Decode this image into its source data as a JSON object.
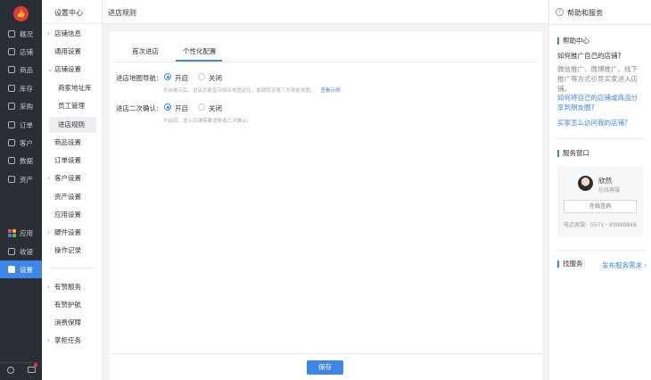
{
  "nav": {
    "logo_glyph": "👍",
    "items": [
      {
        "label": "概况",
        "icon": "overview-icon"
      },
      {
        "label": "店铺",
        "icon": "store-icon"
      },
      {
        "label": "商品",
        "icon": "tag-icon"
      },
      {
        "label": "库存",
        "icon": "inventory-icon"
      },
      {
        "label": "采购",
        "icon": "purchase-icon"
      },
      {
        "label": "订单",
        "icon": "order-icon"
      },
      {
        "label": "客户",
        "icon": "customer-icon"
      },
      {
        "label": "数据",
        "icon": "chart-icon"
      },
      {
        "label": "资产",
        "icon": "asset-icon"
      }
    ],
    "apps": "应用",
    "cashier": "收银",
    "settings": "设置",
    "accent": "#3b86e8"
  },
  "menu": {
    "title": "设置中心",
    "store_info": "店铺信息",
    "general": "通用设置",
    "store_settings": "店铺设置",
    "merchant_address": "商家地址库",
    "staff": "员工管理",
    "entry_rules": "进店规则",
    "product_settings": "商品设置",
    "order_settings": "订单设置",
    "customer_settings": "客户设置",
    "asset_settings": "资产设置",
    "app_settings": "应用设置",
    "hardware": "硬件设置",
    "logs": "操作记录",
    "youzan_service": "有赞服务",
    "youzan_guard": "有赞护航",
    "consumer_guarantee": "消费保障",
    "shopkeeper_tasks": "掌柜任务"
  },
  "page": {
    "title": "进店规则",
    "tabs": [
      "首次进店",
      "个性化配置"
    ],
    "map_nav": {
      "label": "进店地图导航:",
      "on": "开启",
      "off": "关闭",
      "hint": "开启展示后，进店页面显示网店地图定位，能跳转至第三方导航地图。",
      "link": "查看示例"
    },
    "confirm": {
      "label": "进店二次确认:",
      "on": "开启",
      "off": "关闭",
      "hint": "开启后，进入店铺需要消费者二次确认。"
    },
    "save": "保存"
  },
  "help": {
    "title": "帮助和服务",
    "center_title": "帮助中心",
    "q1": "如何推广自己的店铺?",
    "a1": "微信推广、微博推广、线下推广等方式引导买家进入店铺。",
    "link1": "如何将自己的店铺或商品分享到朋友圈?",
    "link2": "买家怎么访问我的店铺?",
    "service_title": "服务窗口",
    "agent_name": "欣然",
    "agent_status": "在线客服",
    "consult": "在线咨询",
    "phone": "电话客服：0571－89988848",
    "find_service": "找服务",
    "publish": "发布服务需求 ›"
  }
}
